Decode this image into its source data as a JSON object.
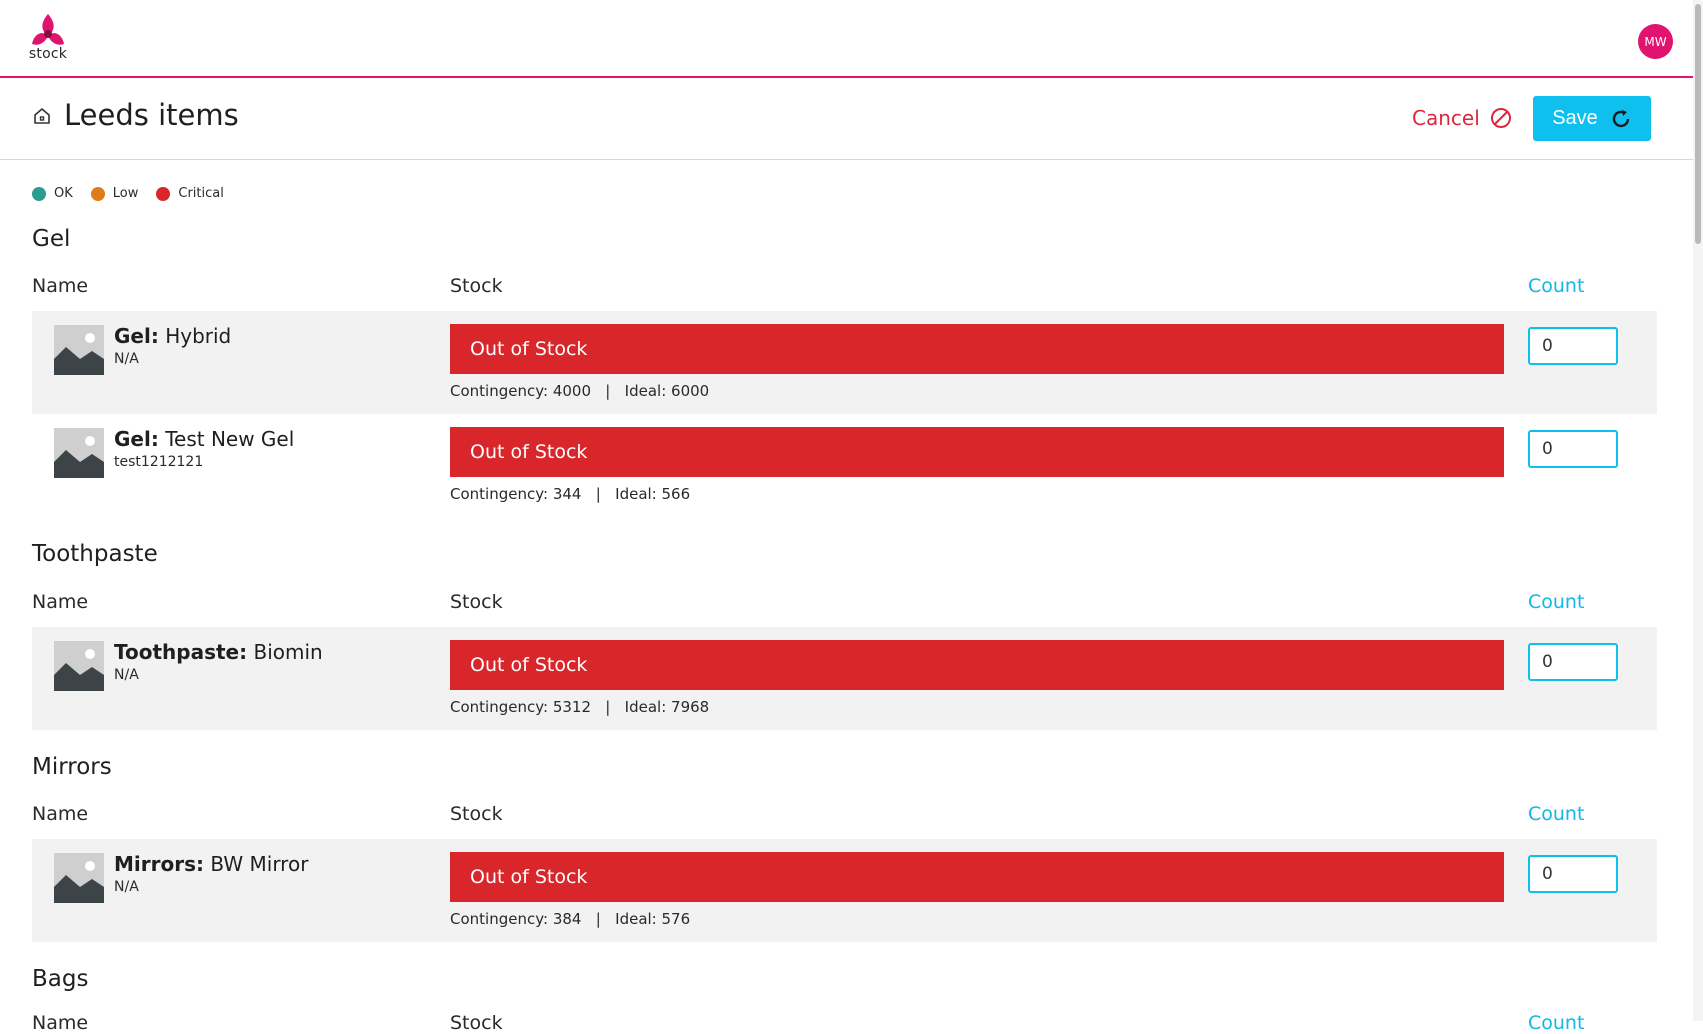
{
  "app": {
    "logo_text": "stock",
    "user_initials": "MW"
  },
  "header": {
    "title": "Leeds items",
    "cancel_label": "Cancel",
    "save_label": "Save"
  },
  "legend": [
    {
      "label": "OK",
      "color": "#2a9d8f"
    },
    {
      "label": "Low",
      "color": "#e07b1a"
    },
    {
      "label": "Critical",
      "color": "#d8262b"
    }
  ],
  "columns": {
    "name": "Name",
    "stock": "Stock",
    "count": "Count"
  },
  "sections": [
    {
      "title": "Gel",
      "items": [
        {
          "category": "Gel:",
          "name": "Hybrid",
          "sub": "N/A",
          "status": "Out of Stock",
          "contingency": "Contingency: 4000",
          "ideal": "Ideal: 6000",
          "count": "0"
        },
        {
          "category": "Gel:",
          "name": "Test New Gel",
          "sub": "test1212121",
          "status": "Out of Stock",
          "contingency": "Contingency: 344",
          "ideal": "Ideal: 566",
          "count": "0"
        }
      ]
    },
    {
      "title": "Toothpaste",
      "items": [
        {
          "category": "Toothpaste:",
          "name": "Biomin",
          "sub": "N/A",
          "status": "Out of Stock",
          "contingency": "Contingency: 5312",
          "ideal": "Ideal: 7968",
          "count": "0"
        }
      ]
    },
    {
      "title": "Mirrors",
      "items": [
        {
          "category": "Mirrors:",
          "name": "BW Mirror",
          "sub": "N/A",
          "status": "Out of Stock",
          "contingency": "Contingency: 384",
          "ideal": "Ideal: 576",
          "count": "0"
        }
      ]
    },
    {
      "title": "Bags",
      "items": []
    }
  ],
  "colors": {
    "brand": "#e0136f",
    "accent": "#0fc0ee",
    "critical": "#d8262b",
    "cancel": "#e0263b"
  }
}
